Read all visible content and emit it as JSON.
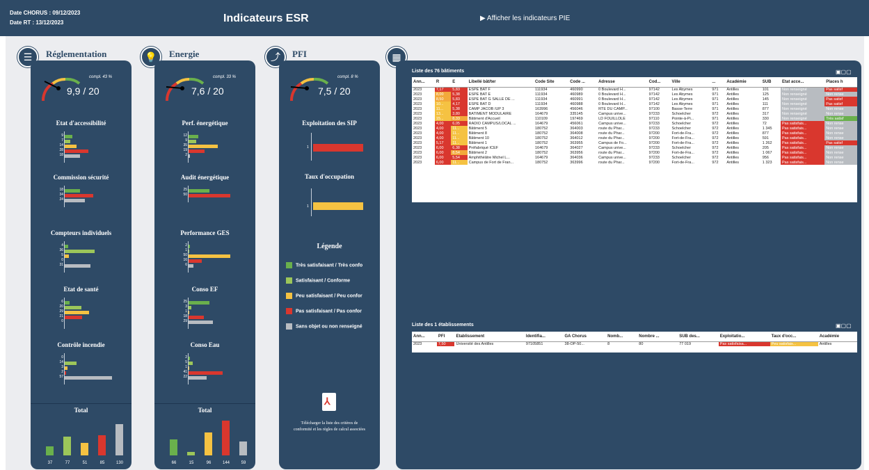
{
  "header": {
    "date_chorus": "Date CHORUS : 09/12/2023",
    "date_rt": "Date RT : 13/12/2023",
    "title": "Indicateurs ESR",
    "pie_link": "▶ Afficher les indicateurs PIE"
  },
  "colors": {
    "navy": "#2e4a66",
    "green": "#6ab04c",
    "lightgreen": "#9cc65a",
    "yellow": "#f5c242",
    "red": "#d9372e",
    "grey": "#b8bcc1"
  },
  "sections": {
    "reglementation": {
      "title": "Réglementation",
      "gauge_compl": "compl. 43 %",
      "gauge_value": "9,9 / 20",
      "gauge_fraction": 0.495,
      "groups": [
        {
          "title": "Etat d'accessibilité",
          "values": [
            9,
            7,
            14,
            28,
            18
          ]
        },
        {
          "title": "Commission sécurité",
          "values": [
            18,
            34,
            24
          ]
        },
        {
          "title": "Compteurs individuels",
          "values": [
            4,
            36,
            5,
            0,
            31
          ]
        },
        {
          "title": "Etat de santé",
          "values": [
            6,
            20,
            29,
            21,
            0
          ]
        },
        {
          "title": "Contrôle incendie",
          "values": [
            0,
            14,
            3,
            2,
            57
          ]
        }
      ],
      "total_title": "Total",
      "totals": [
        37,
        77,
        51,
        85,
        130
      ]
    },
    "energie": {
      "title": "Energie",
      "gauge_compl": "compl. 33 %",
      "gauge_value": "7,6 / 20",
      "gauge_fraction": 0.38,
      "groups": [
        {
          "title": "Perf. énergétique",
          "values": [
            12,
            9,
            35,
            19,
            2
          ]
        },
        {
          "title": "Audit énergétique",
          "values": [
            25,
            50
          ]
        },
        {
          "title": "Performance GES",
          "values": [
            2,
            1,
            50,
            16,
            6
          ]
        },
        {
          "title": "Conso EF",
          "values": [
            25,
            3,
            1,
            18,
            29
          ]
        },
        {
          "title": "Conso Eau",
          "values": [
            2,
            5,
            1,
            41,
            22
          ]
        }
      ],
      "total_title": "Total",
      "totals": [
        66,
        15,
        96,
        144,
        59
      ]
    },
    "pfi": {
      "title": "PFI",
      "gauge_compl": "compl. 8 %",
      "gauge_value": "7,5 / 20",
      "gauge_fraction": 0.375,
      "sub1": "Exploitation des SIP",
      "sub1_value": "1",
      "sub2": "Taux d'occupation",
      "sub2_value": "1",
      "legend_title": "Légende",
      "legend": [
        {
          "label": "Très satisfaisant / Très confo",
          "color": "#6ab04c"
        },
        {
          "label": "Satisfaisant / Conforme",
          "color": "#9cc65a"
        },
        {
          "label": "Peu satisfaisant / Peu confor",
          "color": "#f5c242"
        },
        {
          "label": "Pas satisfaisant / Pas confor",
          "color": "#d9372e"
        },
        {
          "label": "Sans objet ou non renseigné",
          "color": "#b8bcc1"
        }
      ],
      "download_text": "Télécharger la liste des critères de conformité et les règles de calcul associées"
    }
  },
  "batiments": {
    "caption": "Liste des 76 bâtiments",
    "columns": [
      "Ann...",
      "R",
      "E",
      "Libellé bât/ter",
      "Code Site",
      "Code ...",
      "Adresse",
      "Cod...",
      "Ville",
      "...",
      "Académie",
      "SUB",
      "Etat acce...",
      "Places h"
    ],
    "rows": [
      [
        "2023",
        "7,17",
        "5,83",
        "ESPE BAT F",
        "111934",
        "460990",
        "0  Boulevard H...",
        "97142",
        "Les Abymes",
        "971",
        "Antilles",
        "101",
        "Non renseigné",
        "Pas satisf"
      ],
      [
        "2023",
        "8,00",
        "5,38",
        "ESPE BAT E",
        "111934",
        "460989",
        "0  Boulevard H...",
        "97142",
        "Les Abymes",
        "971",
        "Antilles",
        "125",
        "Non renseigné",
        "Non rense"
      ],
      [
        "2023",
        "8,50",
        "5,83",
        "ESPE BAT G SALLE DE ...",
        "111934",
        "460991",
        "0  Boulevard H...",
        "97142",
        "Les Abymes",
        "971",
        "Antilles",
        "145",
        "Non renseigné",
        "Pas satisf"
      ],
      [
        "2023",
        "10...",
        "4,17",
        "ESPE BAT D",
        "111934",
        "460988",
        "0  Boulevard H...",
        "97142",
        "Les Abymes",
        "971",
        "Antilles",
        "111",
        "Non renseigné",
        "Pas satisf"
      ],
      [
        "2023",
        "11...",
        "5,38",
        "CAMP JACOB /UP 3",
        "163996",
        "456046",
        "RTE DU CAMP...",
        "97100",
        "Basse-Terre",
        "971",
        "Antilles",
        "877",
        "Non renseigné",
        "Non rense"
      ],
      [
        "2023",
        "13...",
        "3,80",
        "BATIMENT MODULAIRE",
        "164679",
        "335145",
        "Campus unive...",
        "97233",
        "Schoelcher",
        "972",
        "Antilles",
        "317",
        "Non renseigné",
        "Non rense"
      ],
      [
        "2023",
        "15...",
        "8,33",
        "Bâtiment d'Accueil",
        "110109",
        "197469",
        "LD FOUILLOLE",
        "97110",
        "Pointe-à-Pi...",
        "971",
        "Antilles",
        "330",
        "Non renseigné",
        "Très satisf"
      ],
      [
        "2023",
        "4,00",
        "6,05",
        "RADIO CAMPUS/LOCAL ...",
        "164679",
        "456061",
        "Campus unive...",
        "97233",
        "Schoelcher",
        "972",
        "Antilles",
        "72",
        "Pas satisfais...",
        "Non rense"
      ],
      [
        "2023",
        "4,00",
        "11...",
        "Bâtiment  5",
        "180752",
        "364003",
        "route du Phar...",
        "97233",
        "Schoelcher",
        "972",
        "Antilles",
        "1 345",
        "Pas satisfais...",
        "Non rense"
      ],
      [
        "2023",
        "4,00",
        "11...",
        "Bâtiment 8",
        "180752",
        "364008",
        "route du Phar...",
        "97200",
        "Fort-de-Fra...",
        "972",
        "Antilles",
        "877",
        "Pas satisfais...",
        "Non rense"
      ],
      [
        "2023",
        "4,00",
        "11...",
        "Bâtiment  10",
        "180752",
        "364012",
        "route du Phar...",
        "97200",
        "Fort-de-Fra...",
        "972",
        "Antilles",
        "591",
        "Pas satisfais...",
        "Non rense"
      ],
      [
        "2023",
        "5,17",
        "11...",
        "Bâtiment  1",
        "180752",
        "363955",
        "Campus de Fo...",
        "97200",
        "Fort-de-Fra...",
        "972",
        "Antilles",
        "1 262",
        "Pas satisfais...",
        "Pas satisf"
      ],
      [
        "2023",
        "6,00",
        "6,38",
        "Préfabriqué ICEF",
        "164679",
        "364027",
        "Campus unive...",
        "97233",
        "Schoelcher",
        "972",
        "Antilles",
        "205",
        "Pas satisfais...",
        "Non rense"
      ],
      [
        "2023",
        "6,00",
        "8,54",
        "Bâtiment  2",
        "180752",
        "363956",
        "route du Phar...",
        "97200",
        "Fort-de-Fra...",
        "972",
        "Antilles",
        "1 067",
        "Pas satisfais...",
        "Non rense"
      ],
      [
        "2023",
        "6,00",
        "5,54",
        "Amphithéâtre  Michel L...",
        "164679",
        "364036",
        "Campus unive...",
        "97233",
        "Schoelcher",
        "972",
        "Antilles",
        "956",
        "Pas satisfais...",
        "Non rense"
      ],
      [
        "2023",
        "6,00",
        "11...",
        "Campus de Fort de Fran...",
        "180752",
        "363996",
        "route du Phar...",
        "97200",
        "Fort-de-Fra...",
        "972",
        "Antilles",
        "1 323",
        "Pas satisfais...",
        "Non rense"
      ]
    ]
  },
  "etablissements": {
    "caption": "Liste des 1 établissements",
    "columns": [
      "Ann...",
      "PFI",
      "Etablissement",
      "Identifia...",
      "GA Chorus",
      "Nomb...",
      "Nombre ...",
      "SUB des...",
      "Exploitatio...",
      "Taux d'occ...",
      "Académie"
    ],
    "rows": [
      [
        "2023",
        "7,50",
        "Université des Antilles",
        "97105851",
        "38-OP-50...",
        "8",
        "80",
        "77 019",
        "Pas satisfaisa...",
        "Peu satisfais...",
        "Antilles"
      ]
    ]
  }
}
